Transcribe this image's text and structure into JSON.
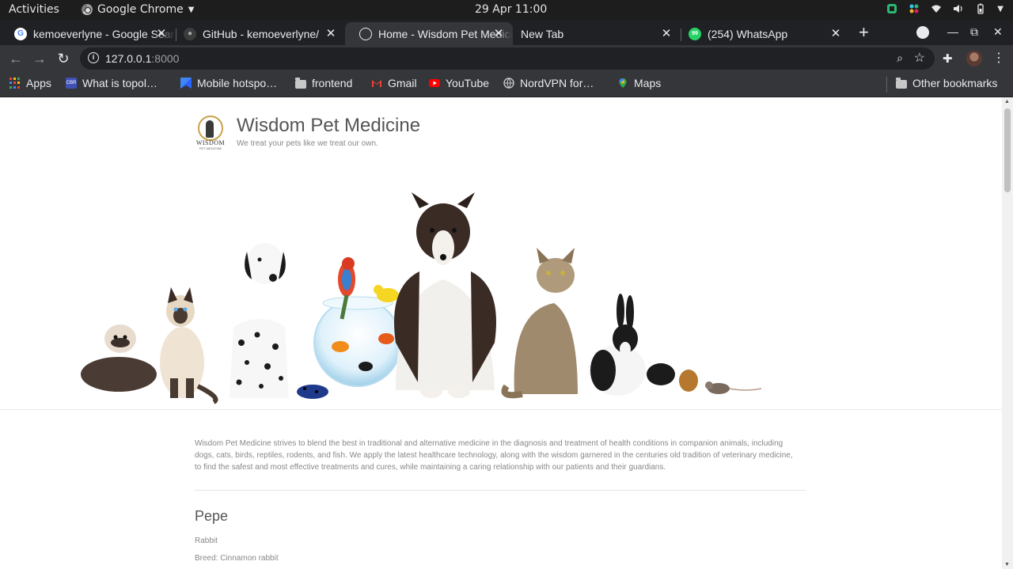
{
  "os_bar": {
    "activities": "Activities",
    "app_name": "Google Chrome",
    "clock": "29 Apr  11:00"
  },
  "tabs": [
    {
      "title": "kemoeverlyne - Google Search",
      "favicon": "google-icon",
      "active": false
    },
    {
      "title": "GitHub - kemoeverlyne/",
      "favicon": "github-icon",
      "active": false
    },
    {
      "title": "Home - Wisdom Pet Medicine",
      "favicon": "globe-icon",
      "active": true
    },
    {
      "title": "New Tab",
      "favicon": "",
      "active": false
    },
    {
      "title": "(254) WhatsApp",
      "favicon": "whatsapp-icon",
      "active": false
    }
  ],
  "omnibox": {
    "host": "127.0.0.1",
    "port": ":8000"
  },
  "bookmarks": [
    {
      "label": "Apps",
      "icon": "apps-grid-icon"
    },
    {
      "label": "What is topol…",
      "icon": "cbr-icon"
    },
    {
      "label": "Mobile hotspo…",
      "icon": "bookmark-flag-icon"
    },
    {
      "label": "frontend",
      "icon": "folder-icon"
    },
    {
      "label": "Gmail",
      "icon": "gmail-icon"
    },
    {
      "label": "YouTube",
      "icon": "youtube-icon"
    },
    {
      "label": "NordVPN for…",
      "icon": "globe-icon"
    },
    {
      "label": "Maps",
      "icon": "maps-icon"
    },
    {
      "label": "Other bookmarks",
      "icon": "folder-icon"
    }
  ],
  "site": {
    "title": "Wisdom Pet Medicine",
    "tagline": "We treat your pets like we treat our own.",
    "logo_text": "WISDOM",
    "logo_sub": "PET MEDICINE",
    "intro": "Wisdom Pet Medicine strives to blend the best in traditional and alternative medicine in the diagnosis and treatment of health conditions in companion animals, including dogs, cats, birds, reptiles, rodents, and fish. We apply the latest healthcare technology, along with the wisdom garnered in the centuries old tradition of veterinary medicine, to find the safest and most effective treatments and cures, while maintaining a caring relationship with our patients and their guardians.",
    "pet": {
      "name": "Pepe",
      "kind": "Rabbit",
      "breed": "Breed: Cinnamon rabbit"
    }
  },
  "colors": {
    "os_bar": "#1d1d1d",
    "tab_strip": "#202124",
    "toolbar": "#35363a",
    "accent_gold": "#c8a24a"
  }
}
